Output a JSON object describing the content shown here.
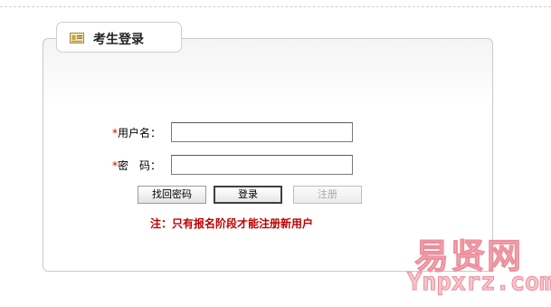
{
  "header": {
    "title": "考生登录",
    "icon": "id-card-icon"
  },
  "form": {
    "username": {
      "required_mark": "*",
      "label": "用户名：",
      "value": ""
    },
    "password": {
      "required_mark": "*",
      "label": "密　码：",
      "value": ""
    }
  },
  "buttons": {
    "find_password": "找回密码",
    "login": "登录",
    "register": "注册"
  },
  "notice": "注：只有报名阶段才能注册新用户",
  "watermark": {
    "cn": "易贤网",
    "en": "Ynpxrz.com"
  },
  "colors": {
    "notice": "#c00000",
    "required": "#cc0000",
    "watermark": "#f7c4cb"
  }
}
